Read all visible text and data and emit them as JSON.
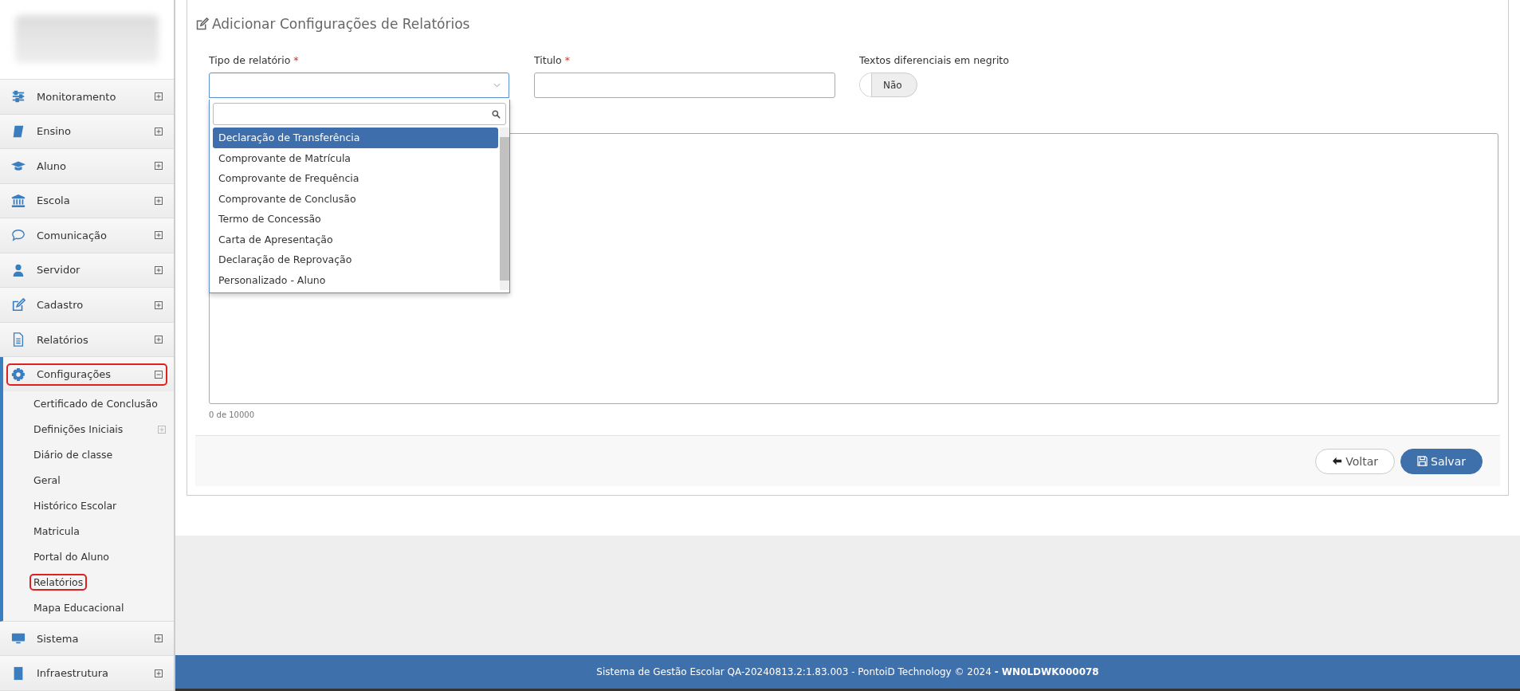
{
  "sidebar": {
    "items": [
      {
        "label": "Monitoramento",
        "kind": "sliders",
        "expanded": false,
        "highlighted": false
      },
      {
        "label": "Ensino",
        "kind": "book",
        "expanded": false,
        "highlighted": false
      },
      {
        "label": "Aluno",
        "kind": "cap",
        "expanded": false,
        "highlighted": false
      },
      {
        "label": "Escola",
        "kind": "bank",
        "expanded": false,
        "highlighted": false
      },
      {
        "label": "Comunicação",
        "kind": "chat",
        "expanded": false,
        "highlighted": false
      },
      {
        "label": "Servidor",
        "kind": "user",
        "expanded": false,
        "highlighted": false
      },
      {
        "label": "Cadastro",
        "kind": "edit",
        "expanded": false,
        "highlighted": false
      },
      {
        "label": "Relatórios",
        "kind": "file",
        "expanded": false,
        "highlighted": false
      },
      {
        "label": "Configurações",
        "kind": "gear",
        "expanded": true,
        "highlighted": true,
        "children": [
          {
            "label": "Certificado de Conclusão",
            "expandable": false,
            "highlighted": false
          },
          {
            "label": "Definições Iniciais",
            "expandable": true,
            "highlighted": false
          },
          {
            "label": "Diário de classe",
            "expandable": false,
            "highlighted": false
          },
          {
            "label": "Geral",
            "expandable": false,
            "highlighted": false
          },
          {
            "label": "Histórico Escolar",
            "expandable": false,
            "highlighted": false
          },
          {
            "label": "Matricula",
            "expandable": false,
            "highlighted": false
          },
          {
            "label": "Portal do Aluno",
            "expandable": false,
            "highlighted": false
          },
          {
            "label": "Relatórios",
            "expandable": false,
            "highlighted": true
          },
          {
            "label": "Mapa Educacional",
            "expandable": false,
            "highlighted": false
          }
        ]
      },
      {
        "label": "Sistema",
        "kind": "monitor",
        "expanded": false,
        "highlighted": false
      },
      {
        "label": "Infraestrutura",
        "kind": "building",
        "expanded": false,
        "highlighted": false
      }
    ]
  },
  "form": {
    "title": "Adicionar Configurações de Relatórios",
    "report_type": {
      "label": "Tipo de relatório",
      "required": "*",
      "dropdown": {
        "options": [
          {
            "label": "Declaração de Transferência",
            "selected": true
          },
          {
            "label": "Comprovante de Matrícula",
            "selected": false
          },
          {
            "label": "Comprovante de Frequência",
            "selected": false
          },
          {
            "label": "Comprovante de Conclusão",
            "selected": false
          },
          {
            "label": "Termo de Concessão",
            "selected": false
          },
          {
            "label": "Carta de Apresentação",
            "selected": false
          },
          {
            "label": "Declaração de Reprovação",
            "selected": false
          },
          {
            "label": "Personalizado - Aluno",
            "selected": false
          }
        ]
      }
    },
    "title_field": {
      "label": "Titulo",
      "required": "*"
    },
    "bold_toggle": {
      "label": "Textos diferenciais em negrito",
      "value": "Não",
      "on": false
    },
    "counter": "0 de 10000",
    "buttons": {
      "back": "Voltar",
      "save": "Salvar"
    }
  },
  "footer": {
    "text": "Sistema de Gestão Escolar QA-20240813.2:1.83.003 - PontoiD Technology © 2024 ",
    "code": "- WN0LDWK000078"
  }
}
